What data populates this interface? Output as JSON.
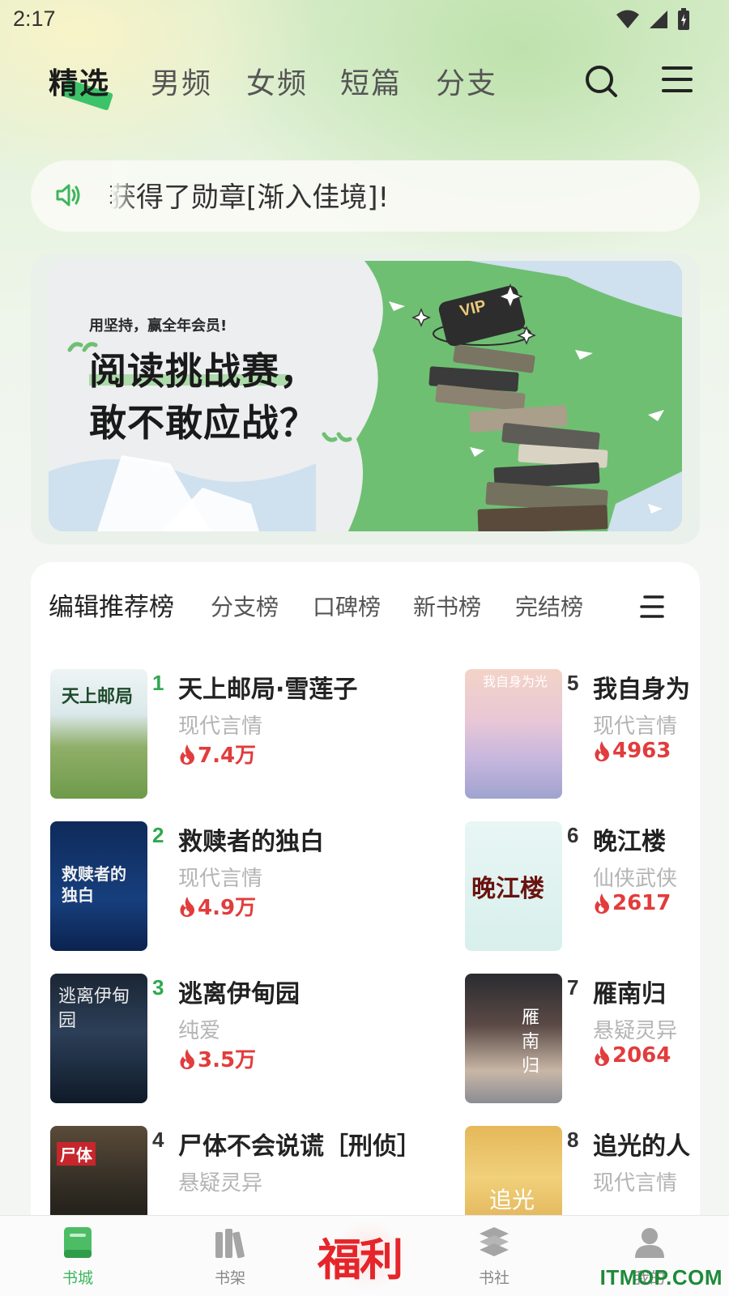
{
  "status_bar": {
    "time": "2:17"
  },
  "top_nav": {
    "tabs": [
      "精选",
      "男频",
      "女频",
      "短篇",
      "分支"
    ],
    "active_index": 0
  },
  "notice": {
    "text": "获得了勋章[渐入佳境]!"
  },
  "banner": {
    "subtitle": "用坚持，赢全年会员!",
    "title_line1": "阅读挑战赛，",
    "title_line2": "敢不敢应战？",
    "badge": "VIP"
  },
  "ranking": {
    "tabs": [
      "编辑推荐榜",
      "分支榜",
      "口碑榜",
      "新书榜",
      "完结榜"
    ],
    "active_index": 0,
    "books": [
      {
        "rank": "1",
        "title": "天上邮局·雪莲子",
        "genre": "现代言情",
        "heat": "7.4万",
        "cover_text": "天上邮局"
      },
      {
        "rank": "2",
        "title": "救赎者的独白",
        "genre": "现代言情",
        "heat": "4.9万",
        "cover_text": "救赎者的独白"
      },
      {
        "rank": "3",
        "title": "逃离伊甸园",
        "genre": "纯爱",
        "heat": "3.5万",
        "cover_text": "逃离伊甸园"
      },
      {
        "rank": "4",
        "title": "尸体不会说谎［刑侦］",
        "genre": "悬疑灵异",
        "heat": "",
        "cover_text": "尸体"
      },
      {
        "rank": "5",
        "title": "我自身为",
        "genre": "现代言情",
        "heat": "4963",
        "cover_text": "我自身为光"
      },
      {
        "rank": "6",
        "title": "晚江楼",
        "genre": "仙侠武侠",
        "heat": "2617",
        "cover_text": "晚江楼"
      },
      {
        "rank": "7",
        "title": "雁南归",
        "genre": "悬疑灵异",
        "heat": "2064",
        "cover_text": "雁南归"
      },
      {
        "rank": "8",
        "title": "追光的人",
        "genre": "现代言情",
        "heat": "",
        "cover_text": "追光"
      }
    ]
  },
  "bottom_nav": {
    "items": [
      "书城",
      "书架",
      "福利",
      "书社",
      "我的"
    ],
    "active_index": 0
  },
  "watermark": "ITMOP.COM",
  "colors": {
    "accent_green": "#3db55c",
    "rank_green": "#2fa84f",
    "heat_red": "#e23c3c",
    "welfare_red": "#e5252a"
  }
}
